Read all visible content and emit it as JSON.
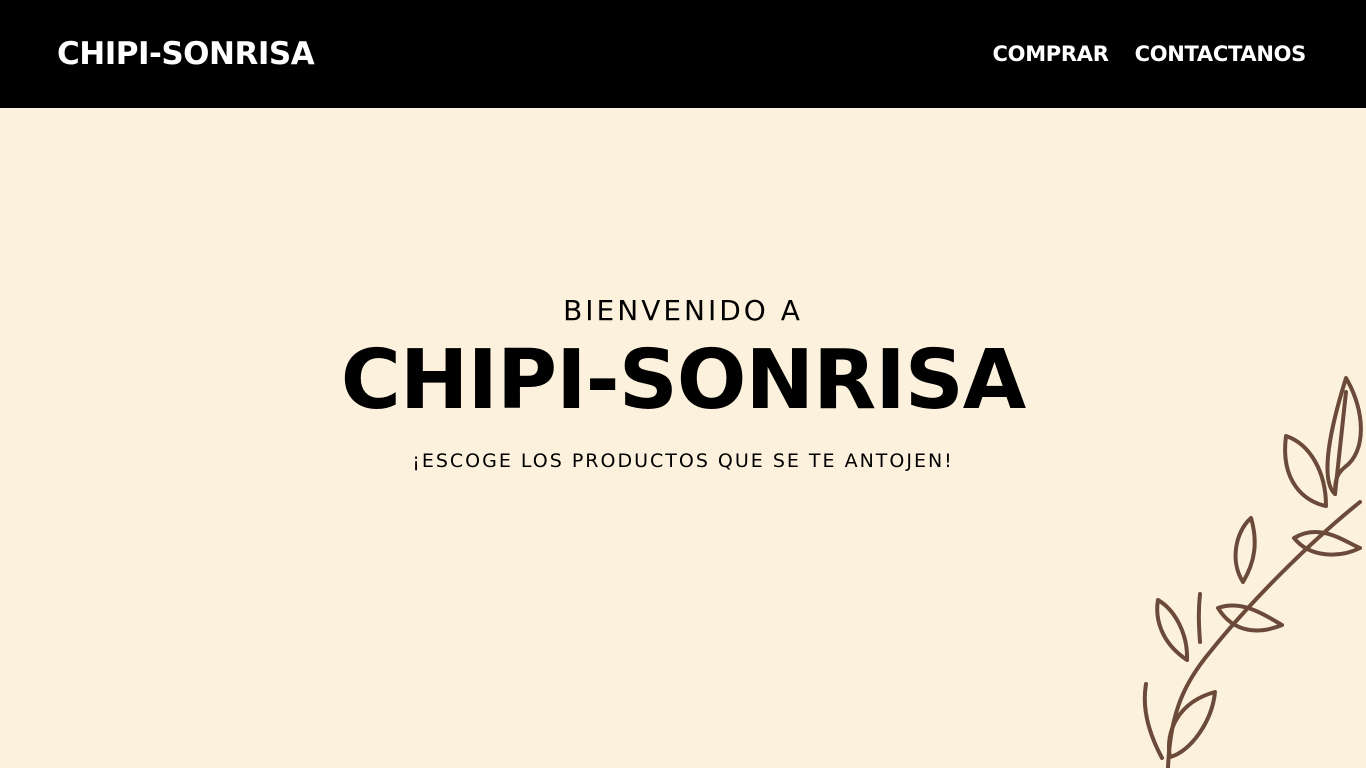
{
  "header": {
    "brand": "CHIPI-SONRISA",
    "nav": {
      "buy_label": "COMPRAR",
      "contact_label": "CONTACTANOS"
    }
  },
  "hero": {
    "welcome": "BIENVENIDO A",
    "title": "CHIPI-SONRISA",
    "tagline": "¡ESCOGE LOS PRODUCTOS QUE SE TE ANTOJEN!"
  },
  "decoration": {
    "icon": "leaf-branch-icon",
    "color": "#6b4a3a"
  },
  "colors": {
    "navbar_bg": "#000000",
    "page_bg": "#fcf1dc",
    "text": "#000000",
    "nav_text": "#ffffff"
  }
}
